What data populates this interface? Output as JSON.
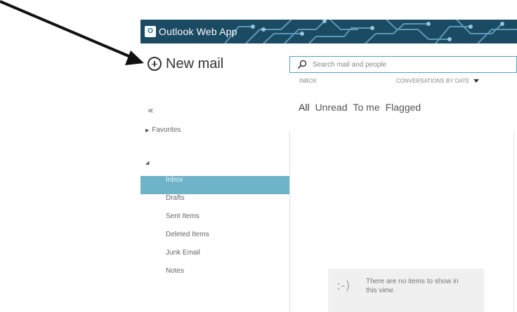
{
  "header": {
    "logo_text": "O",
    "app_title": "Outlook Web App"
  },
  "actions": {
    "new_mail_label": "New mail"
  },
  "search": {
    "placeholder": "Search mail and people"
  },
  "list_header": {
    "folder_caption": "INBOX",
    "sort_label": "CONVERSATIONS BY DATE"
  },
  "filters": [
    "All",
    "Unread",
    "To me",
    "Flagged"
  ],
  "nav": {
    "collapse_glyph": "«",
    "favorites_label": "Favorites",
    "folders": [
      "Inbox",
      "Drafts",
      "Sent Items",
      "Deleted Items",
      "Junk Email",
      "Notes"
    ],
    "selected_folder": "Inbox"
  },
  "empty_state": {
    "face": ":-)",
    "message": "There are no items to show in this view."
  },
  "colors": {
    "banner": "#1b4a63",
    "selected_folder": "#6fb3c9",
    "search_border": "#5a9fc0"
  }
}
